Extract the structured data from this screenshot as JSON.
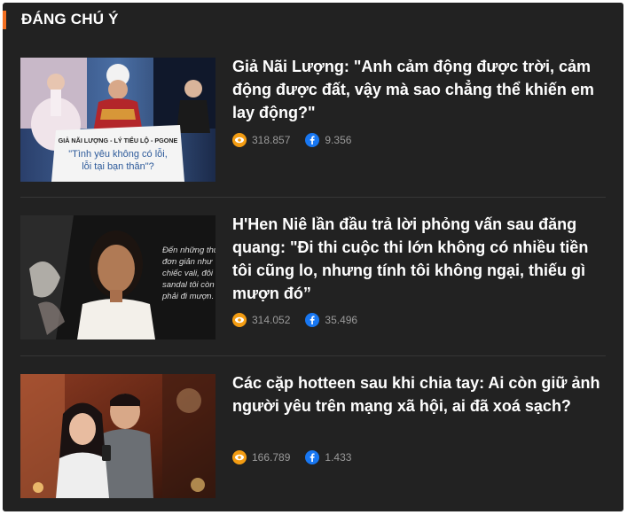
{
  "section": {
    "title": "ĐÁNG CHÚ Ý"
  },
  "colors": {
    "accent": "#f36f21",
    "panel": "#222222",
    "view_icon": "#f39c12",
    "facebook": "#1877f2"
  },
  "articles": [
    {
      "headline": "Giả Nãi Lượng: \"Anh cảm động được trời, cảm động được đất, vậy mà sao chẳng thể khiến em lay động?\"",
      "views": "318.857",
      "shares": "9.356",
      "thumb_caption_top": "GIẢ NÃI LƯỢNG - LÝ TIỂU LỘ - PGONE",
      "thumb_caption_line1": "\"Tình yêu không có lỗi,",
      "thumb_caption_line2": "lỗi tại bạn thân\"?"
    },
    {
      "headline": "H'Hen Niê lần đầu trả lời phỏng vấn sau đăng quang: \"Đi thi cuộc thi lớn không có nhiều tiền tôi cũng lo, nhưng tính tôi không ngại, thiếu gì mượn đó”",
      "views": "314.052",
      "shares": "35.496",
      "thumb_quote_lines": [
        "Đến những thứ",
        "đơn giản như",
        "chiếc vali, đôi",
        "sandal tôi còn",
        "phải đi mượn."
      ]
    },
    {
      "headline": "Các cặp hotteen sau khi chia tay: Ai còn giữ ảnh người yêu trên mạng xã hội, ai đã xoá sạch?",
      "views": "166.789",
      "shares": "1.433"
    }
  ],
  "icons": {
    "views": "eye-icon",
    "shares": "facebook-icon"
  }
}
